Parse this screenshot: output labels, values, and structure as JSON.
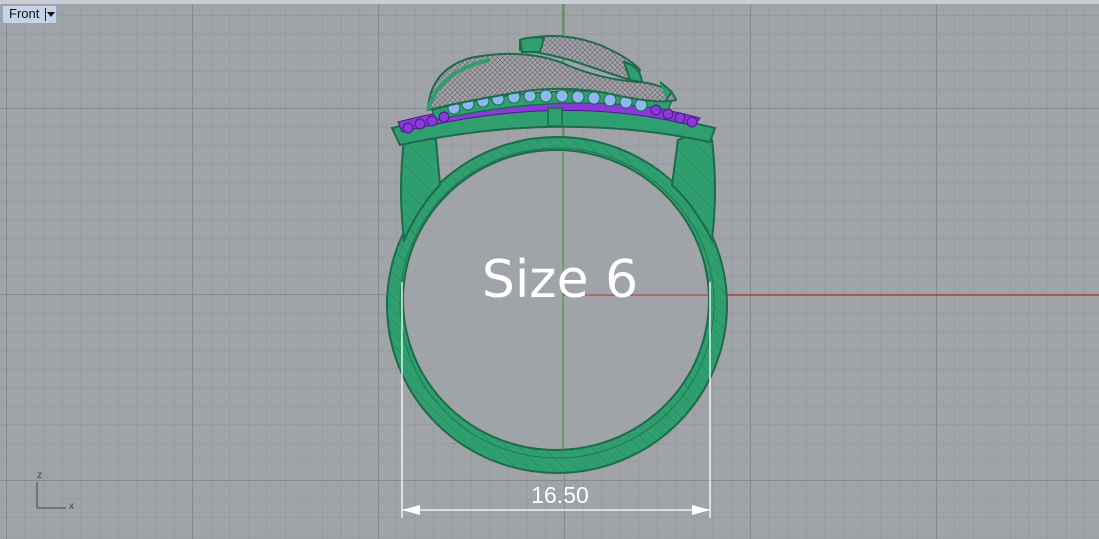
{
  "viewport": {
    "name": "Front",
    "size_label": "Size 6",
    "dimension_value": "16.50"
  },
  "axis_widget": {
    "z_label": "z",
    "x_label": "x"
  },
  "colors": {
    "grid_background": "#a0a4a8",
    "x_axis_line": "#b03030",
    "z_axis_line": "#2f9a2f",
    "ring_green": "#2e9e6e",
    "ring_outline": "#1d6b4a",
    "gem_blue": "#8fb8f0",
    "gem_purple": "#8a3ad8",
    "mesh_gray": "#8c8c90"
  }
}
